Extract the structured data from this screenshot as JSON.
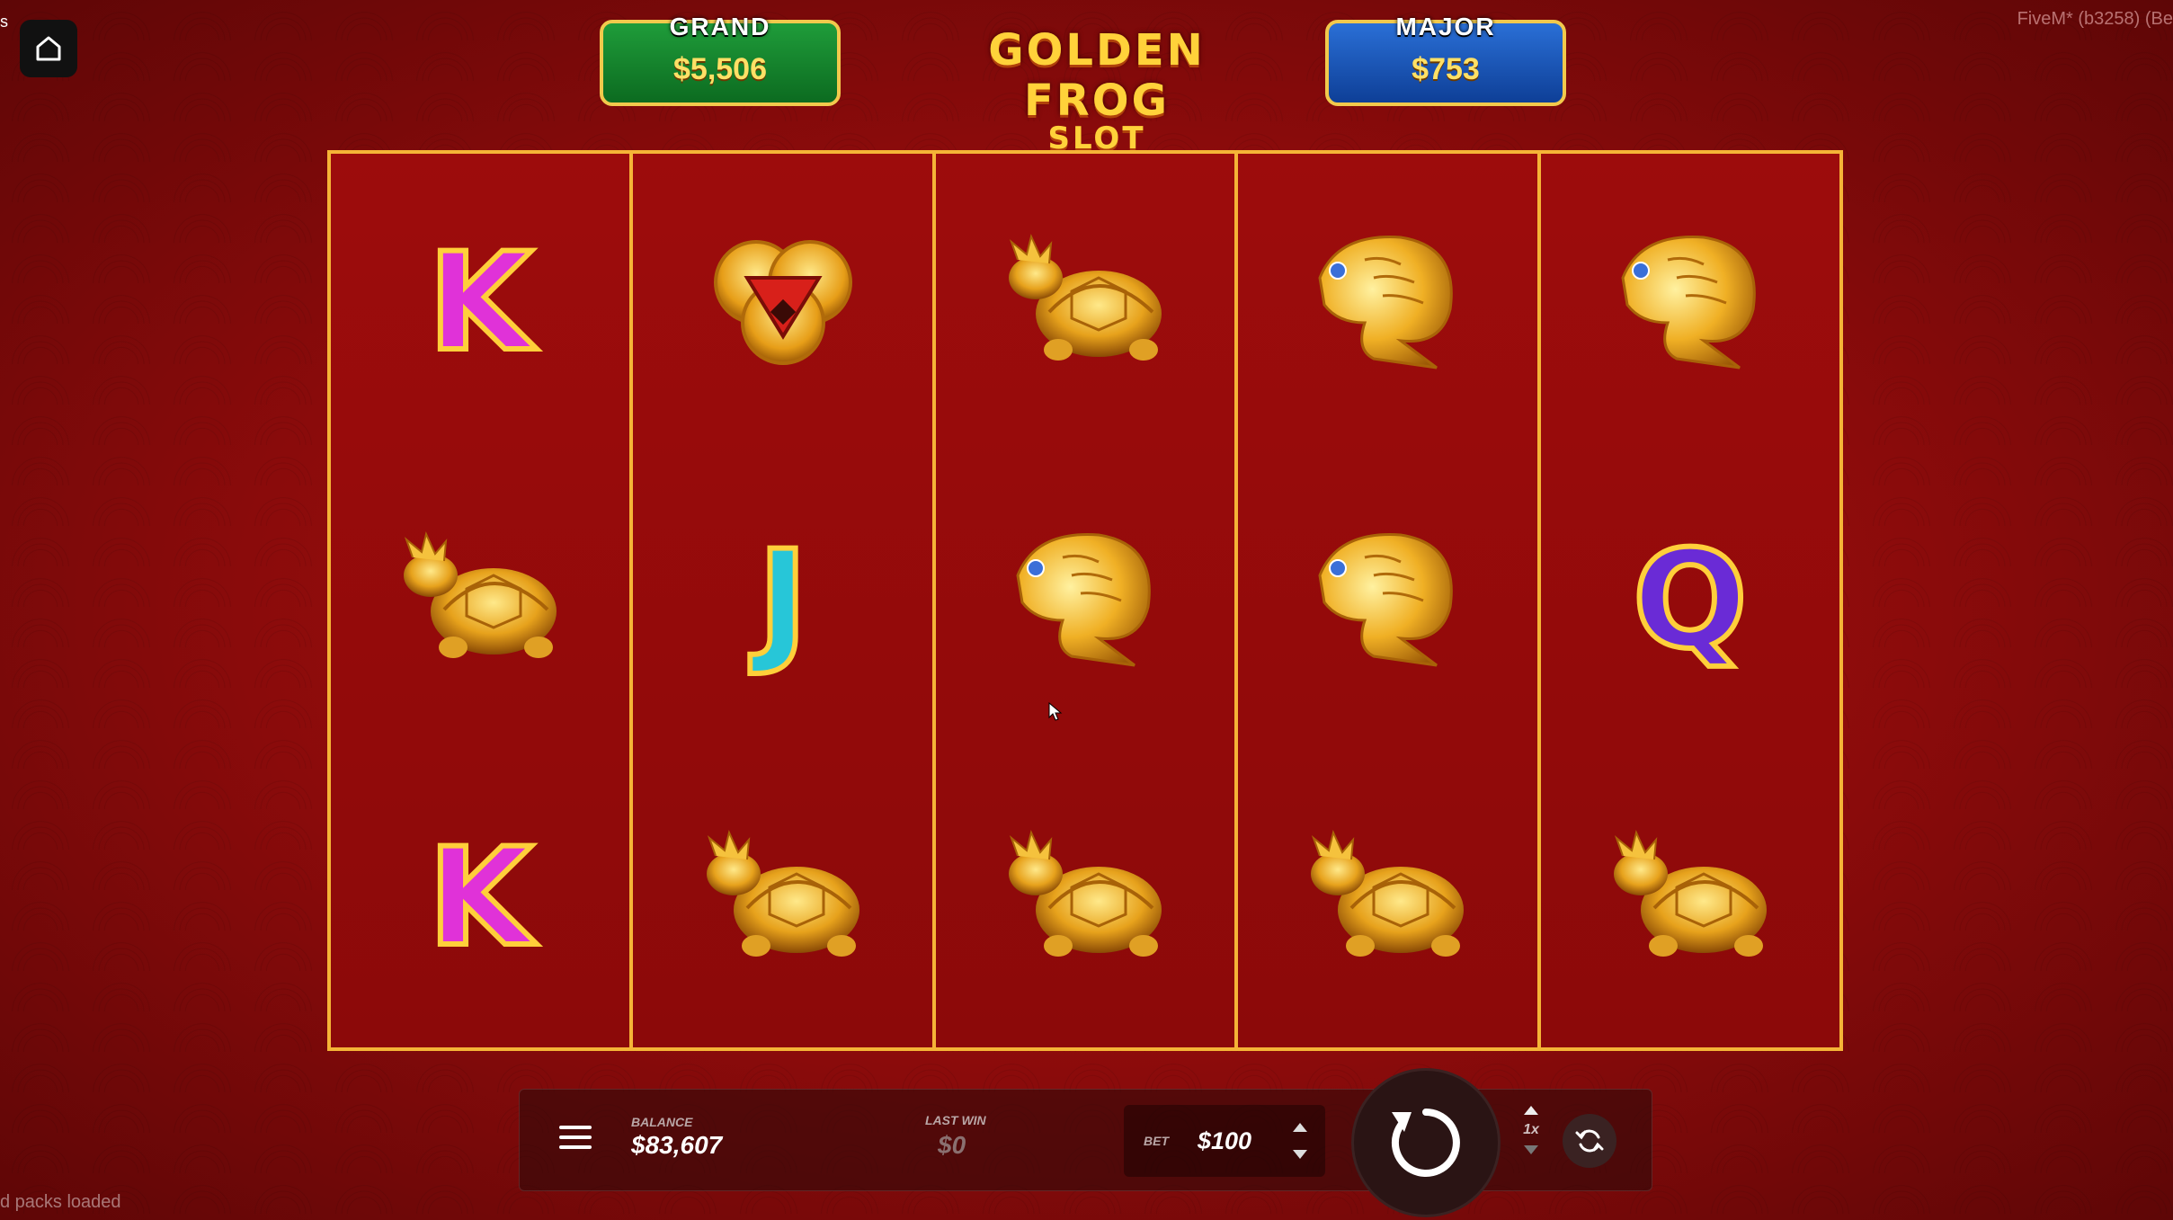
{
  "corner_left": "s",
  "build_info": "FiveM* (b3258) (Be",
  "status_text": "d packs loaded",
  "jackpots": {
    "grand": {
      "label": "GRAND",
      "value": "$5,506"
    },
    "major": {
      "label": "MAJOR",
      "value": "$753"
    }
  },
  "logo": {
    "line1": "GOLDEN FROG",
    "line2": "SLOT"
  },
  "reels": [
    [
      "K",
      "turtle",
      "K"
    ],
    [
      "coins",
      "J",
      "turtle"
    ],
    [
      "turtle",
      "koi",
      "turtle"
    ],
    [
      "koi",
      "koi",
      "turtle"
    ],
    [
      "koi",
      "Q",
      "turtle"
    ]
  ],
  "bottom_bar": {
    "balance_label": "BALANCE",
    "balance_value": "$83,607",
    "last_win_label": "LAST WIN",
    "last_win_value": "$0",
    "bet_label": "BET",
    "bet_value": "$100",
    "speed_label": "1x"
  },
  "icons": {
    "home": "home-icon",
    "menu": "hamburger-menu-icon",
    "spin": "spin-icon",
    "refresh": "autoplay-refresh-icon"
  },
  "colors": {
    "background": "#8a0b0b",
    "reel_border": "#f5b437",
    "grand": "#1f9c3a",
    "major": "#2a6fd6",
    "jackpot_value": "#ffe066"
  }
}
